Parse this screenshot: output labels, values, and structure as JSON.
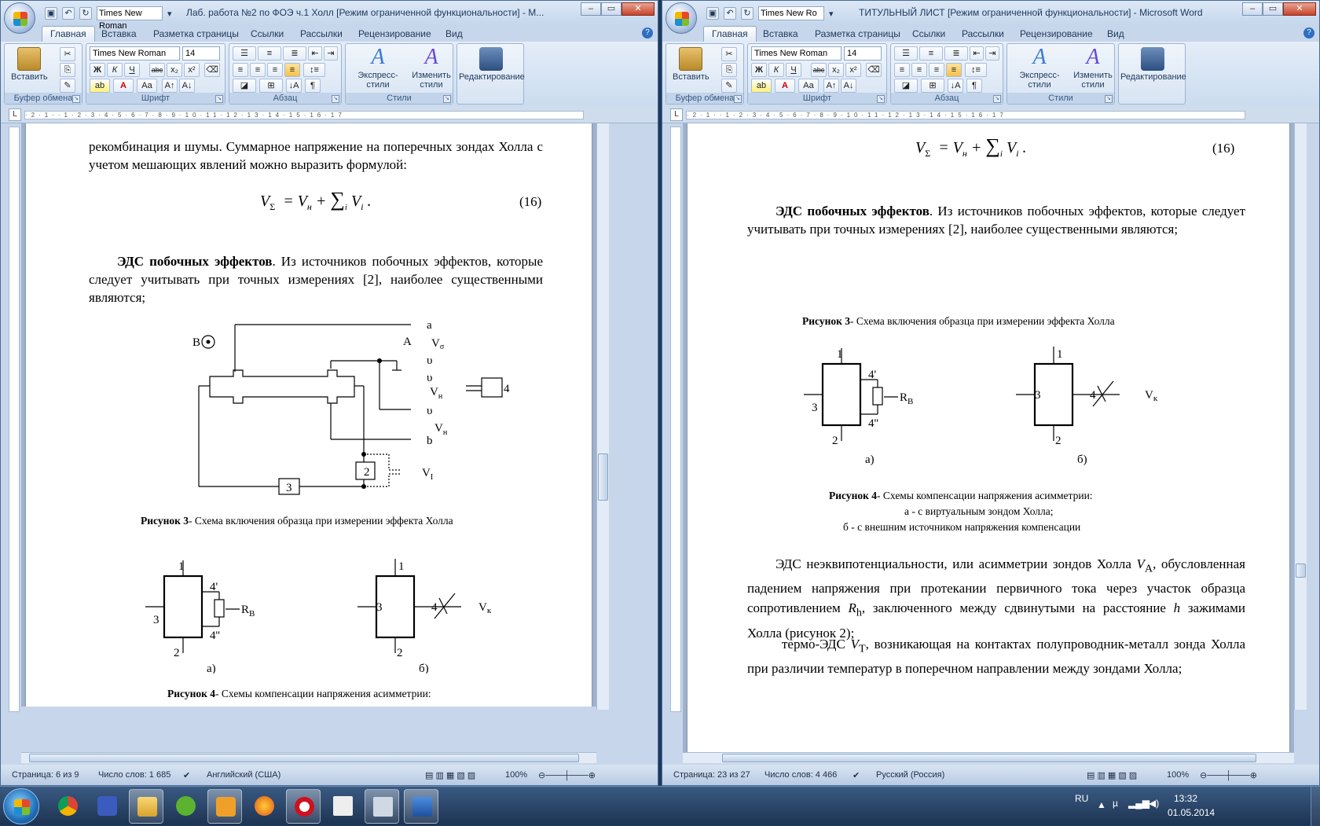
{
  "left": {
    "title": "Лаб. работа №2 по ФОЭ ч.1 Холл [Режим ограниченной функциональности] - M...",
    "font_name": "Times New Roman",
    "font_size": "14",
    "status": {
      "page": "Страница: 6 из 9",
      "words": "Число слов: 1 685",
      "lang": "Английский (США)",
      "zoom": "100%"
    },
    "text": {
      "p1": "рекомбинация и шумы. Суммарное напряжение на поперечных зондах Холла с учетом мешающих явлений можно выразить формулой:",
      "eq_num": "(16)",
      "p2_bold": "ЭДС побочных эффектов",
      "p2": ". Из источников побочных эффектов, которые следует учитывать при точных измерениях [2], наиболее существенными являются;",
      "fig3_bold": "Рисунок 3",
      "fig3": "- Схема включения образца при измерении эффекта Холла",
      "fig4_bold": "Рисунок 4",
      "fig4": "- Схемы компенсации напряжения асимметрии:"
    }
  },
  "right": {
    "title": "ТИТУЛЬНЫЙ ЛИСТ [Режим ограниченной функциональности] - Microsoft Word",
    "font_name": "Times New Ro",
    "font_size": "14",
    "status": {
      "page": "Страница: 23 из 27",
      "words": "Число слов: 4 466",
      "lang": "Русский (Россия)",
      "zoom": "100%"
    },
    "text": {
      "eq_num": "(16)",
      "p1_bold": "ЭДС побочных эффектов",
      "p1": ". Из источников побочных эффектов, которые следует учитывать при точных измерениях [2], наиболее существенными являются;",
      "fig3_bold": "Рисунок 3",
      "fig3": "- Схема включения образца при измерении эффекта Холла",
      "fig4_bold": "Рисунок 4",
      "fig4": "- Схемы компенсации напряжения асимметрии:",
      "fig4_a": "а - с виртуальным зондом Холла;",
      "fig4_b": "б - с внешним источником напряжения компенсации",
      "p3a": "ЭДС неэквипотенциальности, или асимметрии зондов Холла ",
      "p3b": ", обусловленная падением напряжения при протекании первичного тока через участок образца сопротивлением ",
      "p3c": ", заключенного между сдвинутыми на расстояние ",
      "p3d": " зажимами Холла (рисунок 2);",
      "p4a": "термо-ЭДС ",
      "p4b": ", возникающая на контактах полупроводник-металл зонда Холла при различии температур в поперечном направлении между зондами Холла;"
    }
  },
  "ribbon": {
    "tabs": [
      "Главная",
      "Вставка",
      "Разметка страницы",
      "Ссылки",
      "Рассылки",
      "Рецензирование",
      "Вид"
    ],
    "groups": {
      "clipboard": "Буфер обмена",
      "font": "Шрифт",
      "paragraph": "Абзац",
      "styles": "Стили"
    },
    "paste": "Вставить",
    "express_styles": "Экспресс-стили",
    "change_styles": "Изменить стили",
    "editing": "Редактирование"
  },
  "tray": {
    "lang": "RU",
    "time": "13:32",
    "date": "01.05.2014"
  },
  "colors": {
    "accent": "#2e6fc0",
    "ribbon": "#c7d6ea",
    "taskbar": "#1d3352"
  }
}
